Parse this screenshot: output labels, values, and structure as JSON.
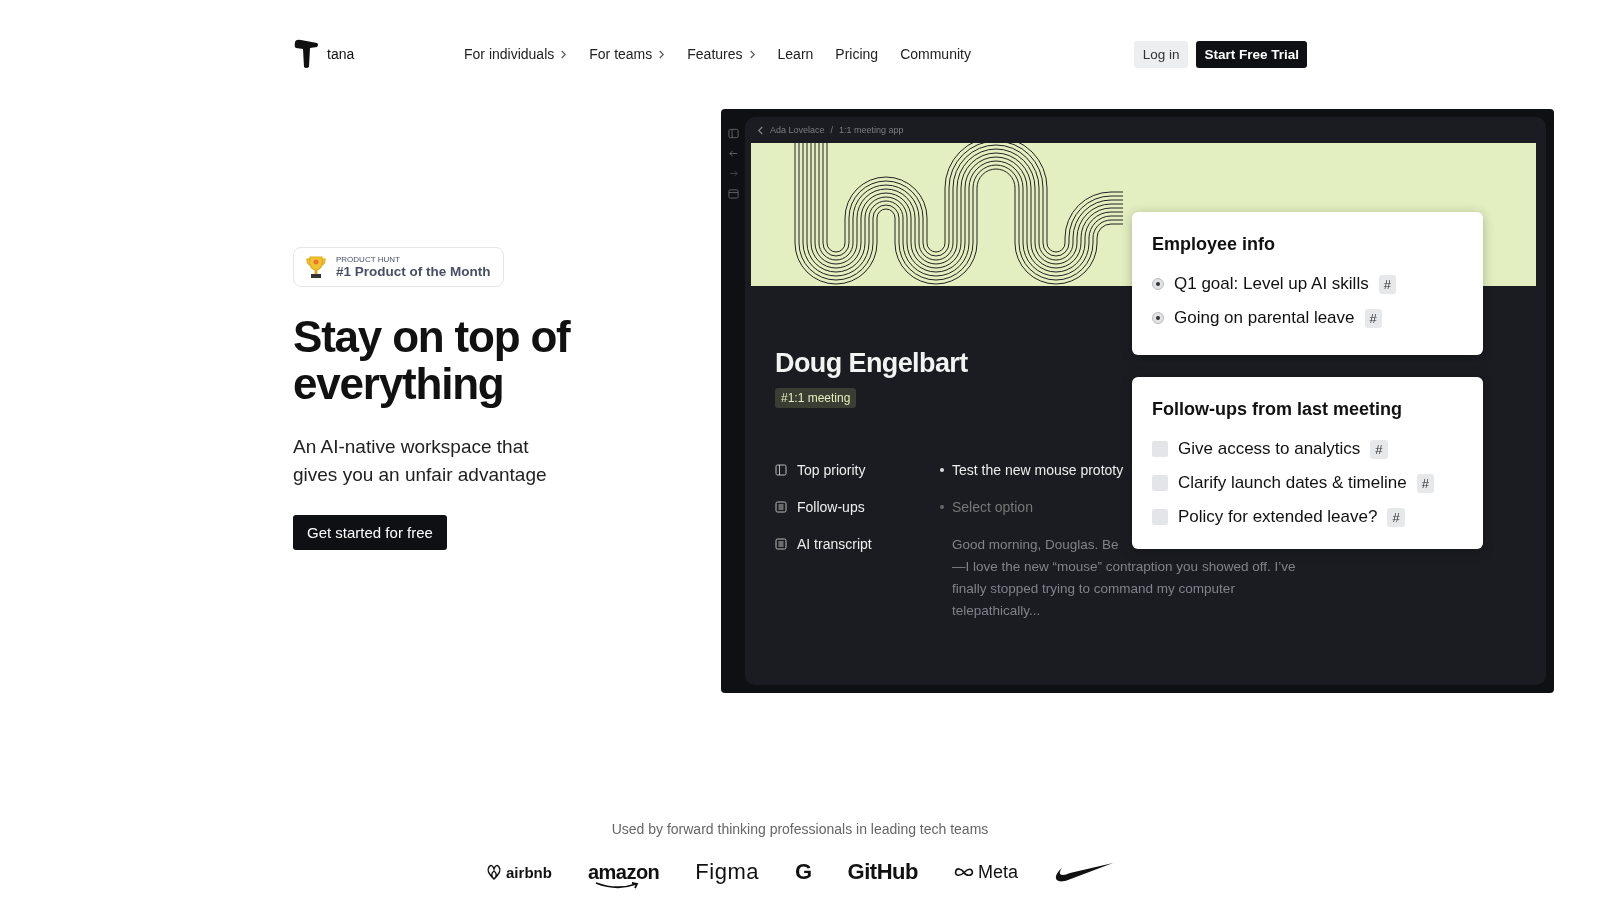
{
  "nav": {
    "brand": "tana",
    "links": [
      {
        "label": "For individuals",
        "has_menu": true
      },
      {
        "label": "For teams",
        "has_menu": true
      },
      {
        "label": "Features",
        "has_menu": true
      },
      {
        "label": "Learn",
        "has_menu": false
      },
      {
        "label": "Pricing",
        "has_menu": false
      },
      {
        "label": "Community",
        "has_menu": false
      }
    ],
    "login": "Log in",
    "trial": "Start Free Trial"
  },
  "hero": {
    "badge": {
      "kicker": "PRODUCT HUNT",
      "title": "#1 Product of the Month"
    },
    "heading": "Stay on top of everything",
    "subheading": "An AI-native workspace that gives you an unfair advantage",
    "cta": "Get started for free"
  },
  "app": {
    "breadcrumb": [
      "Ada Lovelace",
      "1:1 meeting app"
    ],
    "breadcrumb_separator": "/",
    "title": "Doug Engelbart",
    "tag": "#1:1 meeting",
    "fields": [
      {
        "label": "Top priority",
        "kind": "panel",
        "value": "Test the new mouse prototy"
      },
      {
        "label": "Follow-ups",
        "kind": "list",
        "placeholder": "Select option"
      },
      {
        "label": "AI transcript",
        "kind": "list",
        "lines": [
          "Good morning, Douglas. Be",
          "—I love the new “mouse” contraption you showed off. I’ve",
          "finally stopped trying to command my computer",
          "telepathically..."
        ]
      }
    ],
    "cards": [
      {
        "title": "Employee info",
        "items": [
          {
            "kind": "bullet",
            "text": "Q1 goal: Level up AI skills",
            "tag": "#"
          },
          {
            "kind": "bullet",
            "text": "Going on parental leave",
            "tag": "#"
          }
        ]
      },
      {
        "title": "Follow-ups from last meeting",
        "items": [
          {
            "kind": "checkbox",
            "checked": false,
            "text": "Give access to analytics",
            "tag": "#"
          },
          {
            "kind": "checkbox",
            "checked": false,
            "text": "Clarify launch dates & timeline",
            "tag": "#"
          },
          {
            "kind": "checkbox",
            "checked": false,
            "text": "Policy for extended leave?",
            "tag": "#"
          }
        ]
      }
    ]
  },
  "customers": {
    "caption": "Used by forward thinking professionals in leading tech teams",
    "logos": [
      {
        "kind": "airbnb",
        "label": "airbnb"
      },
      {
        "kind": "amazon",
        "label": "amazon"
      },
      {
        "kind": "light",
        "label": "Figma"
      },
      {
        "kind": "heavy",
        "label": "G"
      },
      {
        "kind": "heavy",
        "label": "GitHub"
      },
      {
        "kind": "meta",
        "label": "Meta"
      },
      {
        "kind": "swoosh"
      }
    ]
  }
}
